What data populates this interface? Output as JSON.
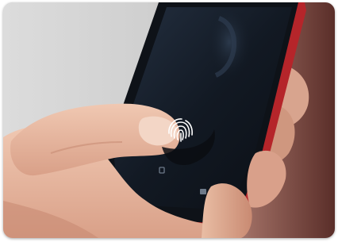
{
  "photo": {
    "subject": "fingerprint-unlock-on-smartphone",
    "colors": {
      "background_light": "#d6d6d6",
      "background_dark_right": "#6e3a34",
      "phone_screen": "#141c26",
      "phone_case_red": "#b5252a",
      "skin": "#e8b9a0",
      "fingerprint_icon": "#ffffff"
    }
  }
}
